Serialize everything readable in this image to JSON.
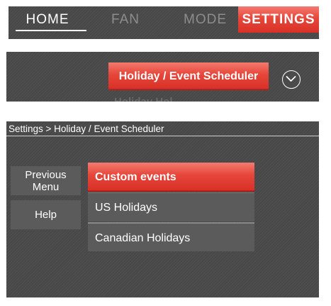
{
  "tabs": {
    "home": "HOME",
    "fan": "FAN",
    "mode": "MODE",
    "settings": "SETTINGS"
  },
  "menu": {
    "holiday_button": "Holiday / Event Scheduler",
    "next_item_partial": "Holiday Hol",
    "scroll_icon": "chevron-down-icon"
  },
  "screen": {
    "breadcrumb": "Settings > Holiday / Event Scheduler",
    "side_buttons": {
      "previous_menu_line1": "Previous",
      "previous_menu_line2": "Menu",
      "help": "Help"
    },
    "list": [
      "Custom events",
      "US Holidays",
      "Canadian Holidays"
    ]
  },
  "colors": {
    "accent_red": "#e6463a",
    "panel_dark": "#4a4a4a",
    "button_gray": "#5b5b5b"
  }
}
